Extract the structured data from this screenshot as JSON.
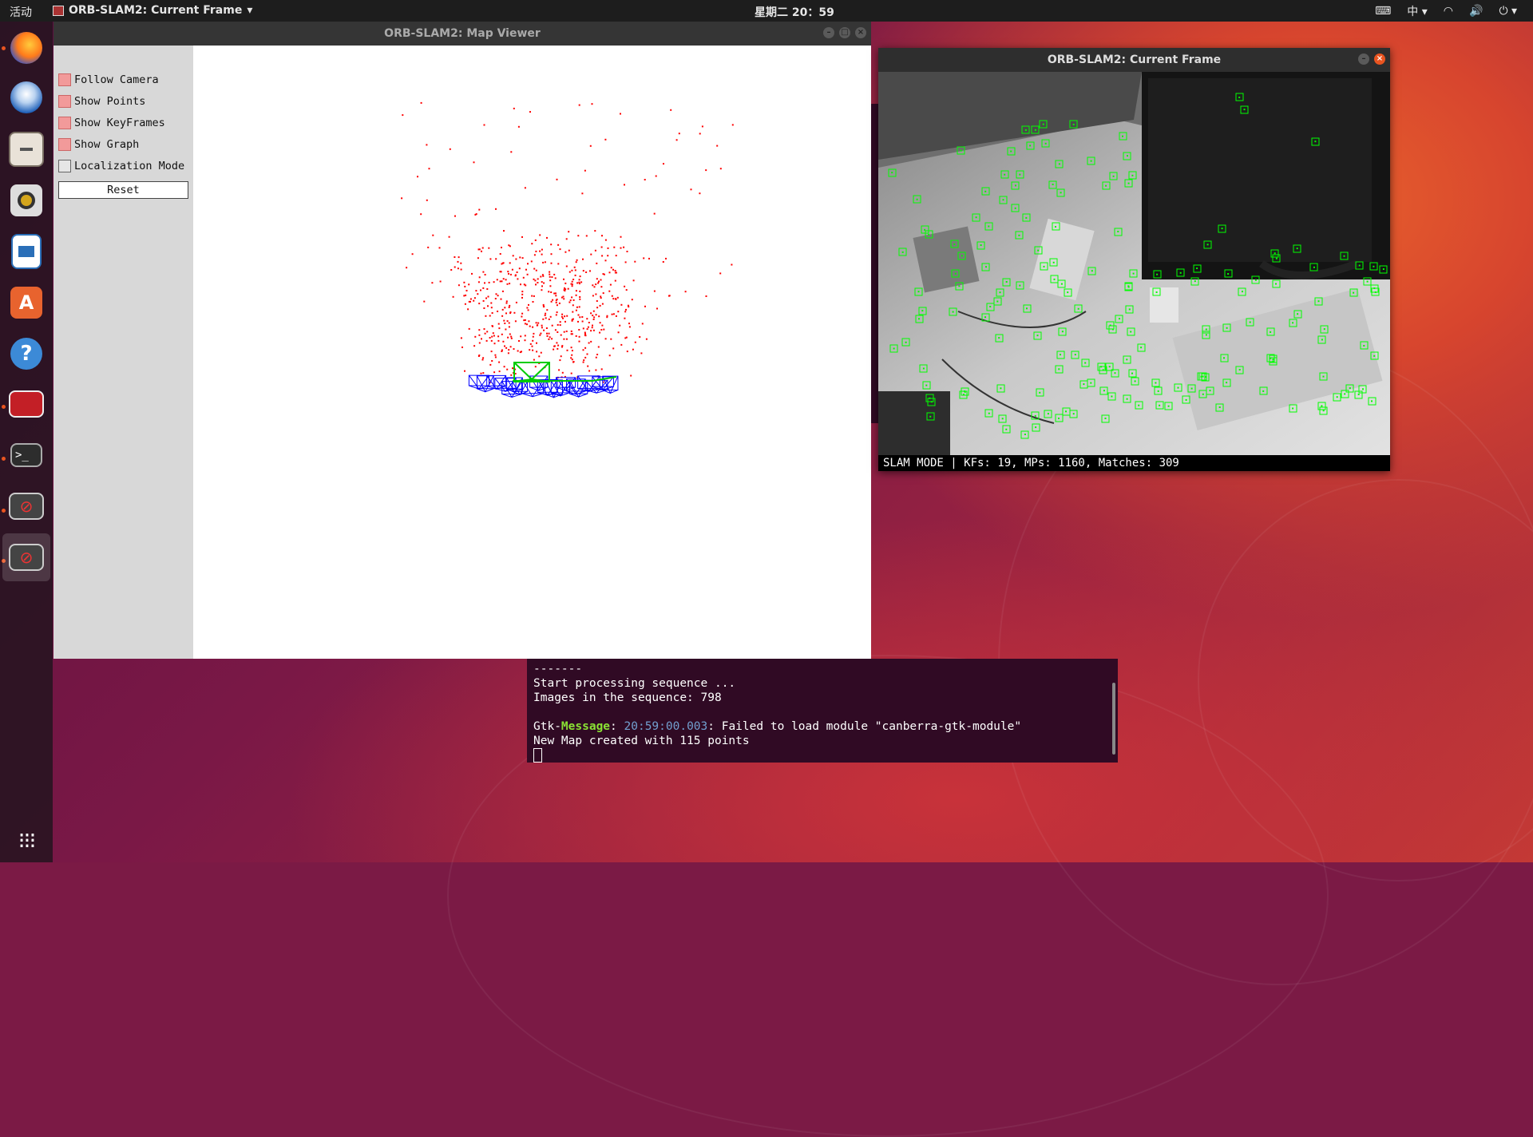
{
  "topbar": {
    "activities": "活动",
    "app_menu": "ORB-SLAM2: Current Frame",
    "clock": "星期二 20：59",
    "input_method": "中"
  },
  "dock": {
    "items": [
      "firefox-icon",
      "thunderbird-icon",
      "files-icon",
      "rhythmbox-icon",
      "libreoffice-writer-icon",
      "software-center-icon",
      "help-icon",
      "orbslam-icon",
      "terminal-icon",
      "blocked-app-icon",
      "blocked-app-icon",
      "show-apps-icon"
    ]
  },
  "map_viewer": {
    "title": "ORB-SLAM2: Map Viewer",
    "options": [
      {
        "label": "Follow Camera",
        "checked": true
      },
      {
        "label": "Show Points",
        "checked": true
      },
      {
        "label": "Show KeyFrames",
        "checked": true
      },
      {
        "label": "Show Graph",
        "checked": true
      },
      {
        "label": "Localization Mode",
        "checked": false
      }
    ],
    "reset_label": "Reset",
    "colors": {
      "map_points": "#ff0000",
      "keyframes": "#0000ff",
      "current_camera": "#00cc00"
    }
  },
  "current_frame": {
    "title": "ORB-SLAM2: Current Frame",
    "status": "SLAM MODE |  KFs: 19, MPs: 1160, Matches: 309",
    "feature_color": "#00ff00"
  },
  "terminal": {
    "lines": {
      "l1": "-------",
      "l2": "Start processing sequence ...",
      "l3": "Images in the sequence: 798",
      "l4a": "Gtk-",
      "l4b": "Message",
      "l4c": ": ",
      "l4d": "20:59:00.003",
      "l4e": ": Failed to load module \"canberra-gtk-module\"",
      "l5": "New Map created with 115 points"
    }
  }
}
